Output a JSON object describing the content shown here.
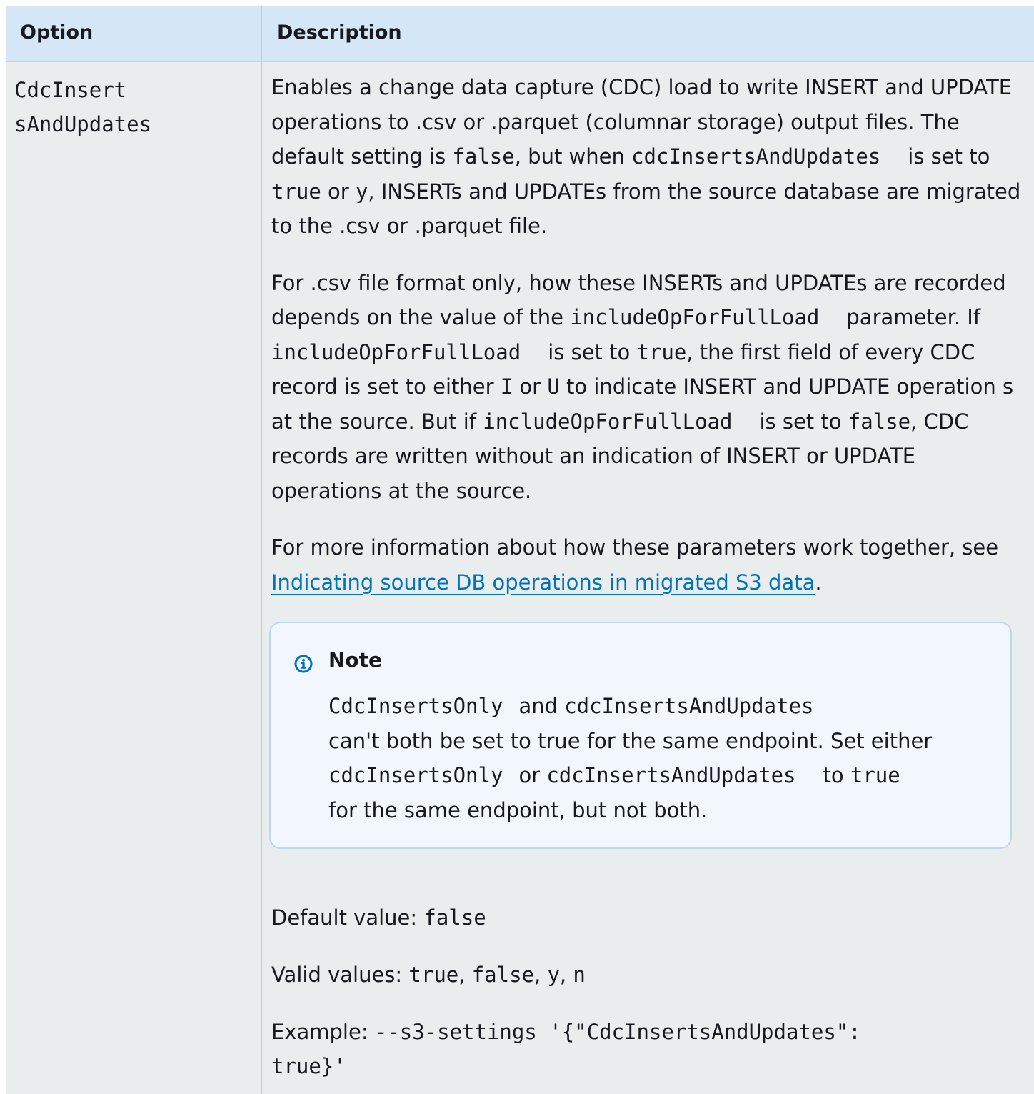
{
  "table": {
    "header": {
      "option": "Option",
      "description": "Description"
    },
    "row": {
      "option_line1": "CdcInsert",
      "option_line2": "sAndUpdates",
      "p1": {
        "t1": "Enables a change data capture (CDC) load to write INSERT and UPDATE operations to .csv or .parquet (columnar storage) output files. The default setting is ",
        "c1": "false",
        "t2": ", but when ",
        "c2": "cdcInsertsAndUpdates",
        "t3": "is set to ",
        "c3": "true",
        "t4": " or ",
        "c4": "y",
        "t5": ", INSERTs and UPDATEs from the source database are migrated to the .csv or .parquet file."
      },
      "p2": {
        "t1": "For .csv file format only, how these INSERTs and UPDATEs are recorded depends on the value of the ",
        "c1": "includeOpForFullLoad",
        "t2": "parameter. If ",
        "c2": "includeOpForFullLoad",
        "t3": "is set to ",
        "c3": "true",
        "t4": ", the first field of every CDC record is set to either ",
        "c4": "I",
        "t5": " or ",
        "c5": "U",
        "t6": " to indicate INSERT and UPDATE operation s at the source. But if ",
        "c6": "includeOpForFullLoad",
        "t7": "is set to ",
        "c7": "false",
        "t8": ", CDC records are written without an indication of INSERT or UPDATE operations at the source."
      },
      "p3": {
        "t1": "For more information about how these parameters work together, see ",
        "link": "Indicating source DB operations in migrated S3 data",
        "t2": "."
      },
      "note": {
        "title": "Note",
        "c1": "CdcInsertsOnly",
        "t1": "and ",
        "c2": "cdcInsertsAndUpdates",
        "t2": "can't both be set to true for the same endpoint. Set either ",
        "c3": "cdcInsertsOnly",
        "t3": "or ",
        "c4": "cdcInsertsAndUpdates",
        "t4": "to ",
        "c5": "true",
        "t5": "for the same endpoint, but not both."
      },
      "default_value": {
        "label": "Default value: ",
        "value": "false"
      },
      "valid_values": {
        "label": "Valid values: ",
        "v1": "true",
        "v2": "false",
        "v3": "y",
        "v4": "n",
        "sep": ", "
      },
      "example": {
        "label": "Example: ",
        "line1": "--s3-settings '{\"CdcInsertsAndUpdates\":",
        "line2": "true}'"
      }
    }
  },
  "colors": {
    "header_bg": "#d5e6f7",
    "body_bg": "#eaeded",
    "link": "#0073bb",
    "note_bg": "#f1f7fc",
    "note_border": "#bfd7ee",
    "info_icon": "#0073bb"
  },
  "icons": {
    "note": "info-circle-icon"
  }
}
